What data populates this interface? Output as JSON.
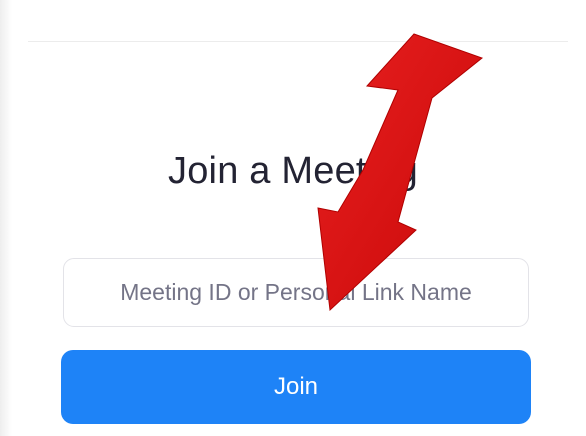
{
  "page": {
    "title": "Join a Meeting"
  },
  "meeting_input": {
    "placeholder": "Meeting ID or Personal Link Name",
    "value": ""
  },
  "join_button": {
    "label": "Join"
  },
  "annotation": {
    "icon": "red-arrow-icon",
    "color": "#dd1010"
  },
  "colors": {
    "accent": "#1e83f7",
    "title_text": "#232333",
    "placeholder_text": "#747487"
  }
}
